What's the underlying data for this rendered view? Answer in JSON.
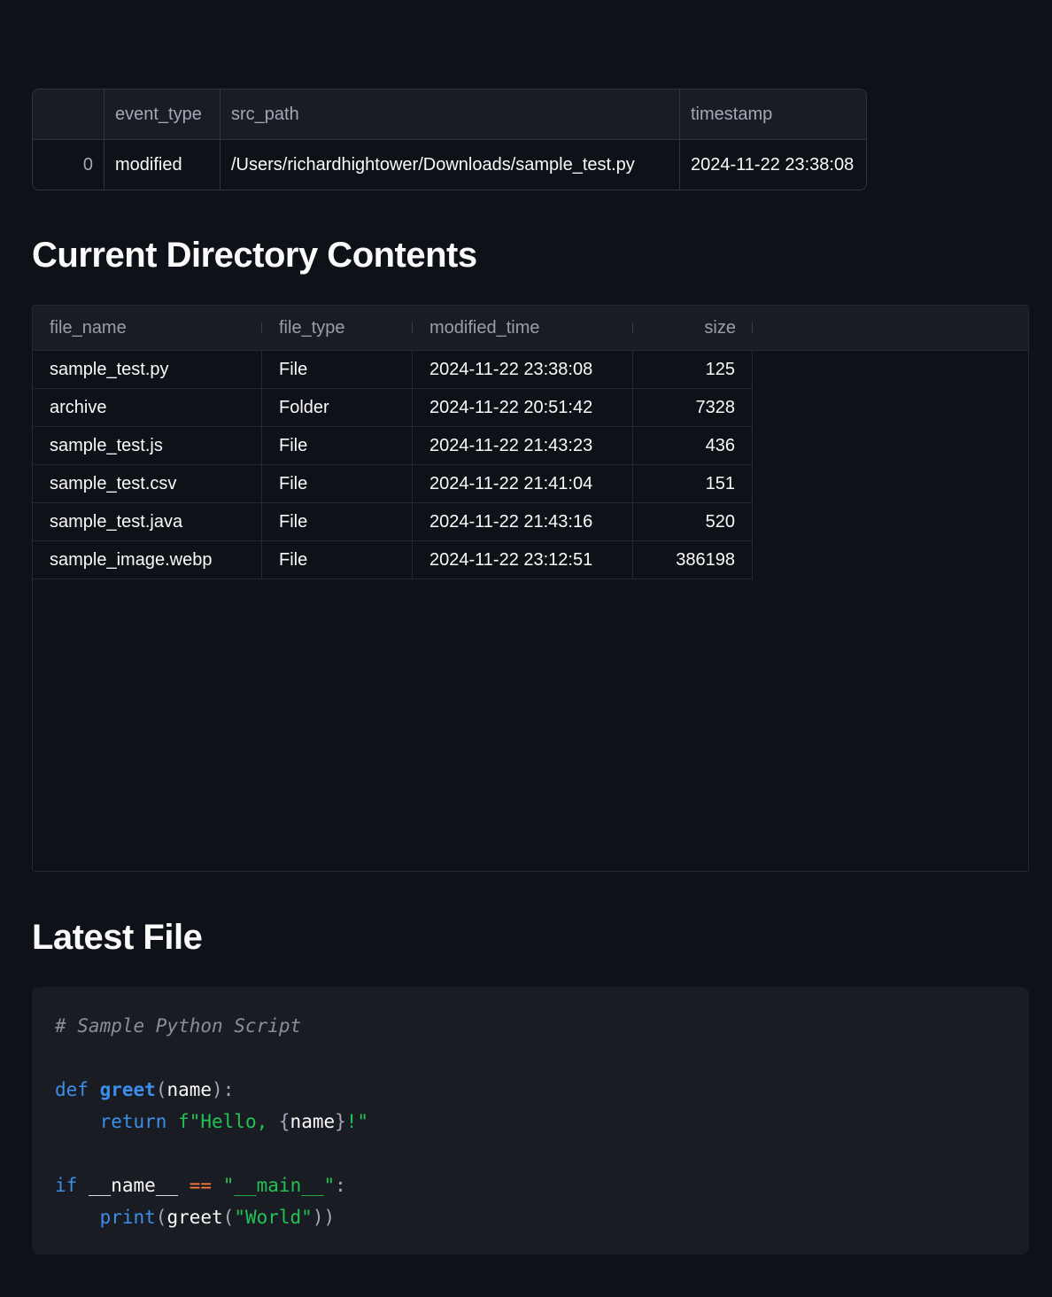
{
  "events": {
    "columns": [
      "",
      "event_type",
      "src_path",
      "timestamp"
    ],
    "rows": [
      {
        "index": "0",
        "event_type": "modified",
        "src_path": "/Users/richardhightower/Downloads/sample_test.py",
        "timestamp": "2024-11-22 23:38:08"
      }
    ]
  },
  "directory": {
    "title": "Current Directory Contents",
    "columns": [
      "file_name",
      "file_type",
      "modified_time",
      "size"
    ],
    "rows": [
      {
        "file_name": "sample_test.py",
        "file_type": "File",
        "modified_time": "2024-11-22 23:38:08",
        "size": "125"
      },
      {
        "file_name": "archive",
        "file_type": "Folder",
        "modified_time": "2024-11-22 20:51:42",
        "size": "7328"
      },
      {
        "file_name": "sample_test.js",
        "file_type": "File",
        "modified_time": "2024-11-22 21:43:23",
        "size": "436"
      },
      {
        "file_name": "sample_test.csv",
        "file_type": "File",
        "modified_time": "2024-11-22 21:41:04",
        "size": "151"
      },
      {
        "file_name": "sample_test.java",
        "file_type": "File",
        "modified_time": "2024-11-22 21:43:16",
        "size": "520"
      },
      {
        "file_name": "sample_image.webp",
        "file_type": "File",
        "modified_time": "2024-11-22 23:12:51",
        "size": "386198"
      }
    ]
  },
  "latest": {
    "title": "Latest File",
    "code": {
      "comment": "# Sample Python Script",
      "def_kw": "def",
      "fn_name": "greet",
      "param": "name",
      "return_kw": "return",
      "fstring_start": "f\"Hello, ",
      "fstring_open": "{",
      "fstring_var": "name",
      "fstring_close": "}",
      "fstring_end": "!\"",
      "if_kw": "if",
      "dunder_name": "__name__",
      "eq_op": "==",
      "main_str": "\"__main__\"",
      "print_fn": "print",
      "greet_call": "greet",
      "world_str": "\"World\""
    }
  }
}
